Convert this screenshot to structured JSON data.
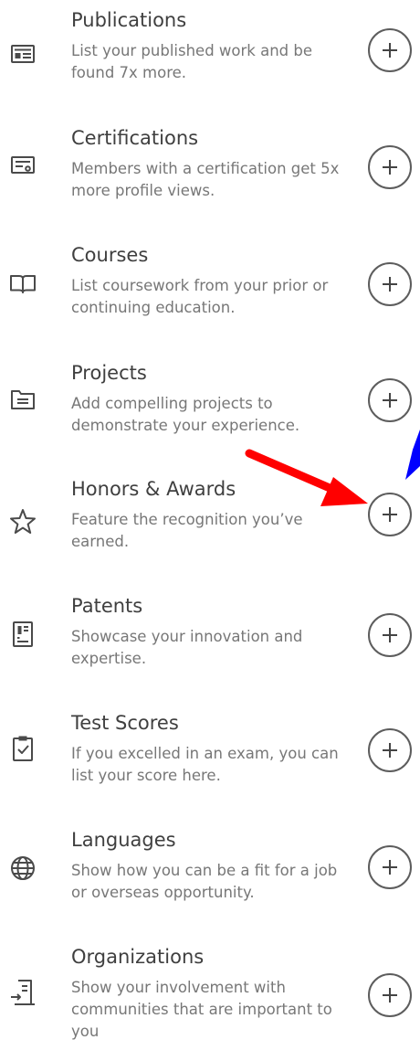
{
  "sections": [
    {
      "title": "Publications",
      "description": "List your published work and be found 7x more.",
      "icon": "publication-icon"
    },
    {
      "title": "Certifications",
      "description": "Members with a certification get 5x more profile views.",
      "icon": "certificate-icon"
    },
    {
      "title": "Courses",
      "description": "List coursework from your prior or continuing education.",
      "icon": "book-icon"
    },
    {
      "title": "Projects",
      "description": "Add compelling projects to demonstrate your experience.",
      "icon": "folder-icon"
    },
    {
      "title": "Honors & Awards",
      "description": "Feature the recognition you’ve earned.",
      "icon": "star-icon"
    },
    {
      "title": "Patents",
      "description": "Showcase your innovation and expertise.",
      "icon": "patent-icon"
    },
    {
      "title": "Test Scores",
      "description": "If you excelled in an exam, you can list your score here.",
      "icon": "clipboard-check-icon"
    },
    {
      "title": "Languages",
      "description": "Show how you can be a fit for a job or overseas opportunity.",
      "icon": "globe-icon"
    },
    {
      "title": "Organizations",
      "description": "Show your involvement with communities that are important to you",
      "icon": "building-entry-icon"
    }
  ],
  "colors": {
    "title_text": "#3f3f3f",
    "description_text": "#777777",
    "icon_stroke": "#4a4a4a",
    "button_border": "#5d5d5d",
    "annotation_arrow_red": "#ff0000",
    "annotation_arrow_blue": "#0000ff"
  }
}
